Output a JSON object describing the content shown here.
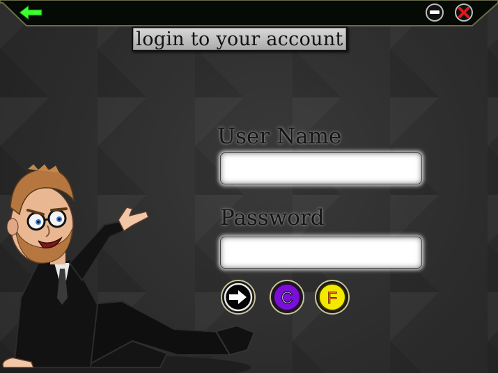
{
  "window": {
    "heading": "login to your account",
    "back_icon": "arrow-left-icon",
    "minimize_icon": "minimize-icon",
    "close_icon": "close-x-icon"
  },
  "form": {
    "username_label": "User Name",
    "username_value": "",
    "password_label": "Password",
    "password_value": ""
  },
  "actions": [
    {
      "id": "go",
      "glyph": "",
      "icon": "arrow-right-icon"
    },
    {
      "id": "c",
      "glyph": "C",
      "icon": "letter-c-icon"
    },
    {
      "id": "f",
      "glyph": "F",
      "icon": "letter-f-icon"
    }
  ],
  "colors": {
    "titlebar": "#050a05",
    "back_arrow": "#3bff2e",
    "close_x": "#e0181a",
    "c_button": "#7a10d8",
    "f_button": "#f2e800"
  }
}
